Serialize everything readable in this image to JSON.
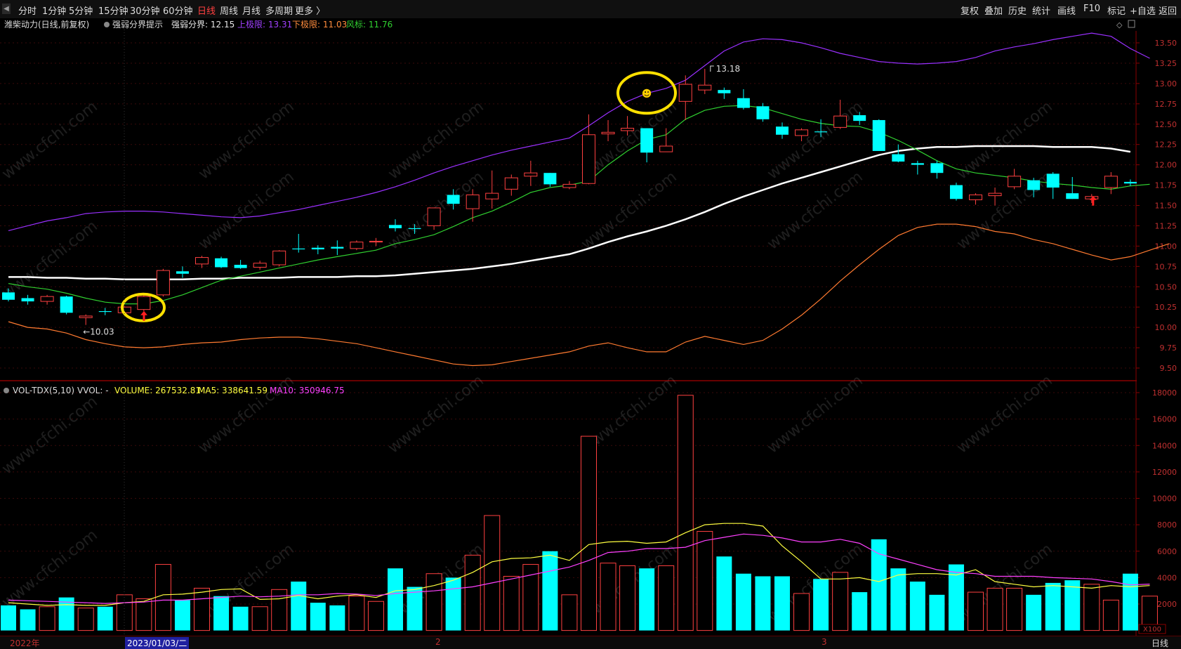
{
  "toolbar": {
    "left_items": [
      "分时",
      "1分钟",
      "5分钟",
      "15分钟",
      "30分钟",
      "60分钟",
      "日线",
      "周线",
      "月线",
      "多周期",
      "更多 〉"
    ],
    "active_item": "日线",
    "right_items": [
      "复权",
      "叠加",
      "历史",
      "统计",
      "画线",
      "F10",
      "标记",
      "+自选",
      "返回"
    ]
  },
  "price_panel": {
    "stock_name": "潍柴动力(日线,前复权)",
    "indicator_name": "强弱分界提示",
    "fields": [
      {
        "label": "强弱分界: 12.15",
        "color": "#e8e8e8"
      },
      {
        "label": "上极限: 13.31",
        "color": "#a040ff"
      },
      {
        "label": "下极限: 11.03",
        "color": "#ff8c3c"
      },
      {
        "label": "风标: 11.76",
        "color": "#30d030"
      }
    ]
  },
  "volume_panel": {
    "indicator_name": "VOL-TDX(5,10)",
    "vvol_label": "VVOL: -",
    "fields": [
      {
        "label": "VOLUME: 267532.81",
        "color": "#ffff40"
      },
      {
        "label": "MA5: 338641.59",
        "color": "#ffff40"
      },
      {
        "label": "MA10: 350946.75",
        "color": "#ff40ff"
      }
    ],
    "unit": "X100"
  },
  "annotations": {
    "low_label": "←10.03",
    "high_label": "13.18",
    "smiley": "☻"
  },
  "watermark": "www.cfchi.com",
  "statusbar": {
    "year": "2022年",
    "date": "2023/01/03/二",
    "month2": "2",
    "month3": "3",
    "period": "日线"
  },
  "colors": {
    "up": "#ff4040",
    "down": "#00ffff",
    "mid_line": "#ffffff",
    "upper_band": "#9a30ff",
    "lower_band": "#ff7a30",
    "wind_line": "#30d030",
    "ma5": "#ffff40",
    "ma10": "#ff40ff",
    "highlight_circle": "#ffe000"
  },
  "chart_data": [
    {
      "type": "candlestick",
      "title": "潍柴动力(日线,前复权)",
      "ylim": [
        9.4,
        13.65
      ],
      "y_ticks": [
        9.5,
        9.75,
        10.0,
        10.25,
        10.5,
        10.75,
        11.0,
        11.25,
        11.5,
        11.75,
        12.0,
        12.25,
        12.5,
        12.75,
        13.0,
        13.25,
        13.5
      ],
      "candles": [
        {
          "o": 10.43,
          "h": 10.48,
          "l": 10.32,
          "c": 10.34
        },
        {
          "o": 10.36,
          "h": 10.4,
          "l": 10.28,
          "c": 10.32
        },
        {
          "o": 10.32,
          "h": 10.4,
          "l": 10.28,
          "c": 10.38
        },
        {
          "o": 10.38,
          "h": 10.39,
          "l": 10.16,
          "c": 10.18
        },
        {
          "o": 10.12,
          "h": 10.16,
          "l": 10.03,
          "c": 10.14
        },
        {
          "o": 10.2,
          "h": 10.24,
          "l": 10.15,
          "c": 10.19
        },
        {
          "o": 10.18,
          "h": 10.26,
          "l": 10.16,
          "c": 10.25
        },
        {
          "o": 10.22,
          "h": 10.42,
          "l": 10.2,
          "c": 10.38
        },
        {
          "o": 10.4,
          "h": 10.72,
          "l": 10.38,
          "c": 10.7
        },
        {
          "o": 10.69,
          "h": 10.75,
          "l": 10.61,
          "c": 10.66
        },
        {
          "o": 10.78,
          "h": 10.88,
          "l": 10.73,
          "c": 10.86
        },
        {
          "o": 10.85,
          "h": 10.87,
          "l": 10.73,
          "c": 10.74
        },
        {
          "o": 10.77,
          "h": 10.83,
          "l": 10.72,
          "c": 10.73
        },
        {
          "o": 10.74,
          "h": 10.82,
          "l": 10.71,
          "c": 10.79
        },
        {
          "o": 10.77,
          "h": 10.95,
          "l": 10.75,
          "c": 10.94
        },
        {
          "o": 10.97,
          "h": 11.15,
          "l": 10.92,
          "c": 10.96
        },
        {
          "o": 10.98,
          "h": 11.01,
          "l": 10.9,
          "c": 10.96
        },
        {
          "o": 10.99,
          "h": 11.07,
          "l": 10.89,
          "c": 10.97
        },
        {
          "o": 10.97,
          "h": 11.07,
          "l": 10.95,
          "c": 11.05
        },
        {
          "o": 11.05,
          "h": 11.1,
          "l": 11.0,
          "c": 11.06
        },
        {
          "o": 11.26,
          "h": 11.33,
          "l": 11.18,
          "c": 11.22
        },
        {
          "o": 11.22,
          "h": 11.27,
          "l": 11.15,
          "c": 11.21
        },
        {
          "o": 11.25,
          "h": 11.47,
          "l": 11.2,
          "c": 11.47
        },
        {
          "o": 11.63,
          "h": 11.7,
          "l": 11.45,
          "c": 11.52
        },
        {
          "o": 11.46,
          "h": 11.7,
          "l": 11.3,
          "c": 11.63
        },
        {
          "o": 11.58,
          "h": 11.93,
          "l": 11.46,
          "c": 11.65
        },
        {
          "o": 11.7,
          "h": 11.88,
          "l": 11.62,
          "c": 11.84
        },
        {
          "o": 11.86,
          "h": 12.05,
          "l": 11.74,
          "c": 11.9
        },
        {
          "o": 11.9,
          "h": 11.9,
          "l": 11.73,
          "c": 11.76
        },
        {
          "o": 11.72,
          "h": 11.8,
          "l": 11.7,
          "c": 11.76
        },
        {
          "o": 11.77,
          "h": 12.62,
          "l": 11.76,
          "c": 12.37
        },
        {
          "o": 12.38,
          "h": 12.55,
          "l": 12.29,
          "c": 12.4
        },
        {
          "o": 12.42,
          "h": 12.6,
          "l": 12.36,
          "c": 12.45
        },
        {
          "o": 12.45,
          "h": 12.45,
          "l": 12.03,
          "c": 12.15
        },
        {
          "o": 12.16,
          "h": 12.45,
          "l": 12.16,
          "c": 12.23
        },
        {
          "o": 12.78,
          "h": 13.1,
          "l": 12.55,
          "c": 12.99
        },
        {
          "o": 12.92,
          "h": 13.18,
          "l": 12.87,
          "c": 12.98
        },
        {
          "o": 12.92,
          "h": 12.95,
          "l": 12.81,
          "c": 12.88
        },
        {
          "o": 12.82,
          "h": 12.93,
          "l": 12.68,
          "c": 12.7
        },
        {
          "o": 12.72,
          "h": 12.76,
          "l": 12.53,
          "c": 12.56
        },
        {
          "o": 12.47,
          "h": 12.52,
          "l": 12.32,
          "c": 12.37
        },
        {
          "o": 12.36,
          "h": 12.45,
          "l": 12.29,
          "c": 12.43
        },
        {
          "o": 12.41,
          "h": 12.56,
          "l": 12.34,
          "c": 12.4
        },
        {
          "o": 12.46,
          "h": 12.8,
          "l": 12.44,
          "c": 12.6
        },
        {
          "o": 12.61,
          "h": 12.65,
          "l": 12.49,
          "c": 12.54
        },
        {
          "o": 12.55,
          "h": 12.56,
          "l": 12.18,
          "c": 12.17
        },
        {
          "o": 12.13,
          "h": 12.25,
          "l": 12.03,
          "c": 12.04
        },
        {
          "o": 12.02,
          "h": 12.05,
          "l": 11.88,
          "c": 12.0
        },
        {
          "o": 12.02,
          "h": 12.05,
          "l": 11.83,
          "c": 11.9
        },
        {
          "o": 11.75,
          "h": 11.78,
          "l": 11.56,
          "c": 11.58
        },
        {
          "o": 11.57,
          "h": 11.65,
          "l": 11.51,
          "c": 11.63
        },
        {
          "o": 11.62,
          "h": 11.72,
          "l": 11.5,
          "c": 11.65
        },
        {
          "o": 11.73,
          "h": 11.95,
          "l": 11.7,
          "c": 11.86
        },
        {
          "o": 11.81,
          "h": 11.84,
          "l": 11.6,
          "c": 11.69
        },
        {
          "o": 11.89,
          "h": 11.91,
          "l": 11.58,
          "c": 11.72
        },
        {
          "o": 11.65,
          "h": 11.85,
          "l": 11.58,
          "c": 11.58
        },
        {
          "o": 11.58,
          "h": 11.64,
          "l": 11.53,
          "c": 11.61
        },
        {
          "o": 11.72,
          "h": 11.91,
          "l": 11.64,
          "c": 11.86
        },
        {
          "o": 11.79,
          "h": 11.82,
          "l": 11.74,
          "c": 11.77
        }
      ],
      "series": [
        {
          "name": "强弱分界",
          "values": [
            10.62,
            10.62,
            10.61,
            10.61,
            10.6,
            10.6,
            10.59,
            10.59,
            10.59,
            10.59,
            10.6,
            10.6,
            10.61,
            10.61,
            10.61,
            10.62,
            10.62,
            10.62,
            10.63,
            10.63,
            10.64,
            10.66,
            10.68,
            10.7,
            10.72,
            10.75,
            10.78,
            10.82,
            10.86,
            10.9,
            10.97,
            11.05,
            11.12,
            11.18,
            11.25,
            11.33,
            11.42,
            11.52,
            11.61,
            11.69,
            11.77,
            11.84,
            11.91,
            11.98,
            12.05,
            12.12,
            12.17,
            12.2,
            12.22,
            12.22,
            12.23,
            12.23,
            12.23,
            12.23,
            12.22,
            12.22,
            12.22,
            12.2,
            12.16
          ]
        },
        {
          "name": "上极限",
          "values": [
            11.19,
            11.25,
            11.31,
            11.35,
            11.4,
            11.42,
            11.43,
            11.43,
            11.42,
            11.4,
            11.38,
            11.36,
            11.35,
            11.37,
            11.41,
            11.45,
            11.5,
            11.55,
            11.6,
            11.66,
            11.73,
            11.81,
            11.9,
            11.98,
            12.05,
            12.12,
            12.18,
            12.23,
            12.28,
            12.33,
            12.48,
            12.64,
            12.78,
            12.88,
            12.94,
            13.04,
            13.22,
            13.4,
            13.51,
            13.55,
            13.54,
            13.5,
            13.44,
            13.37,
            13.32,
            13.27,
            13.25,
            13.24,
            13.25,
            13.27,
            13.32,
            13.4,
            13.45,
            13.49,
            13.54,
            13.58,
            13.62,
            13.58,
            13.43,
            13.31
          ]
        },
        {
          "name": "下极限",
          "values": [
            10.07,
            10.0,
            9.98,
            9.93,
            9.85,
            9.8,
            9.76,
            9.75,
            9.76,
            9.79,
            9.81,
            9.82,
            9.85,
            9.87,
            9.88,
            9.88,
            9.86,
            9.83,
            9.8,
            9.75,
            9.7,
            9.65,
            9.6,
            9.55,
            9.53,
            9.54,
            9.58,
            9.62,
            9.66,
            9.7,
            9.77,
            9.81,
            9.75,
            9.7,
            9.7,
            9.82,
            9.89,
            9.84,
            9.79,
            9.84,
            9.98,
            10.15,
            10.35,
            10.57,
            10.77,
            10.96,
            11.13,
            11.23,
            11.27,
            11.27,
            11.24,
            11.18,
            11.15,
            11.08,
            11.03,
            10.96,
            10.89,
            10.83,
            10.87,
            10.95,
            11.03
          ]
        },
        {
          "name": "风标",
          "values": [
            10.54,
            10.5,
            10.47,
            10.42,
            10.36,
            10.31,
            10.29,
            10.29,
            10.33,
            10.4,
            10.49,
            10.58,
            10.63,
            10.68,
            10.73,
            10.78,
            10.83,
            10.87,
            10.91,
            10.95,
            11.03,
            11.08,
            11.14,
            11.24,
            11.35,
            11.43,
            11.54,
            11.66,
            11.72,
            11.75,
            11.8,
            12.0,
            12.17,
            12.31,
            12.37,
            12.56,
            12.67,
            12.72,
            12.73,
            12.7,
            12.63,
            12.56,
            12.51,
            12.48,
            12.47,
            12.4,
            12.3,
            12.18,
            12.05,
            11.95,
            11.9,
            11.87,
            11.84,
            11.8,
            11.77,
            11.75,
            11.72,
            11.7,
            11.74,
            11.76
          ]
        }
      ],
      "annotations": [
        {
          "text": "←10.03",
          "candle": 4
        },
        {
          "text": "13.18",
          "candle": 36
        }
      ]
    },
    {
      "type": "bar",
      "title": "VOL-TDX(5,10)",
      "ylim": [
        0,
        19000
      ],
      "y_ticks": [
        2000,
        4000,
        6000,
        8000,
        10000,
        12000,
        14000,
        16000,
        18000
      ],
      "values": [
        1900,
        1600,
        1800,
        2500,
        1700,
        1800,
        2700,
        2400,
        5000,
        2300,
        3200,
        2600,
        1800,
        1800,
        3100,
        3700,
        2100,
        1900,
        2600,
        2200,
        4700,
        3300,
        4300,
        4000,
        5700,
        8700,
        4100,
        5000,
        6000,
        2700,
        14700,
        5100,
        4900,
        4700,
        4900,
        17800,
        7500,
        5600,
        4300,
        4100,
        4100,
        2800,
        3900,
        4400,
        2900,
        6900,
        4700,
        3700,
        2700,
        5000,
        2900,
        3200,
        3200,
        2700,
        3600,
        3800,
        3500,
        2300,
        4300,
        2600
      ],
      "series": [
        {
          "name": "MA5",
          "values": [
            2100,
            2000,
            1900,
            1950,
            1900,
            1900,
            2100,
            2200,
            2700,
            2750,
            2900,
            3100,
            3150,
            2350,
            2400,
            2650,
            2400,
            2600,
            2700,
            2500,
            3000,
            3100,
            3400,
            3800,
            4400,
            5200,
            5450,
            5500,
            5700,
            5300,
            6500,
            6700,
            6750,
            6600,
            6700,
            7400,
            8000,
            8100,
            8100,
            7900,
            6400,
            5200,
            3900,
            3900,
            4000,
            3700,
            4200,
            4300,
            4300,
            4200,
            4600,
            3700,
            3500,
            3300,
            3400,
            3300,
            3200,
            3400,
            3300,
            3400
          ]
        },
        {
          "name": "MA10",
          "values": [
            2300,
            2250,
            2200,
            2150,
            2100,
            2050,
            2100,
            2150,
            2300,
            2300,
            2400,
            2500,
            2600,
            2550,
            2600,
            2700,
            2700,
            2800,
            2750,
            2650,
            2800,
            2900,
            3000,
            3150,
            3300,
            3600,
            3900,
            4200,
            4500,
            4800,
            5300,
            5900,
            6000,
            6200,
            6200,
            6300,
            6800,
            7050,
            7300,
            7200,
            7000,
            6700,
            6700,
            6900,
            6600,
            5800,
            5400,
            5000,
            4600,
            4400,
            4300,
            4100,
            4100,
            4100,
            4000,
            3950,
            3900,
            3700,
            3450,
            3510
          ]
        }
      ],
      "unit": "X100"
    }
  ]
}
